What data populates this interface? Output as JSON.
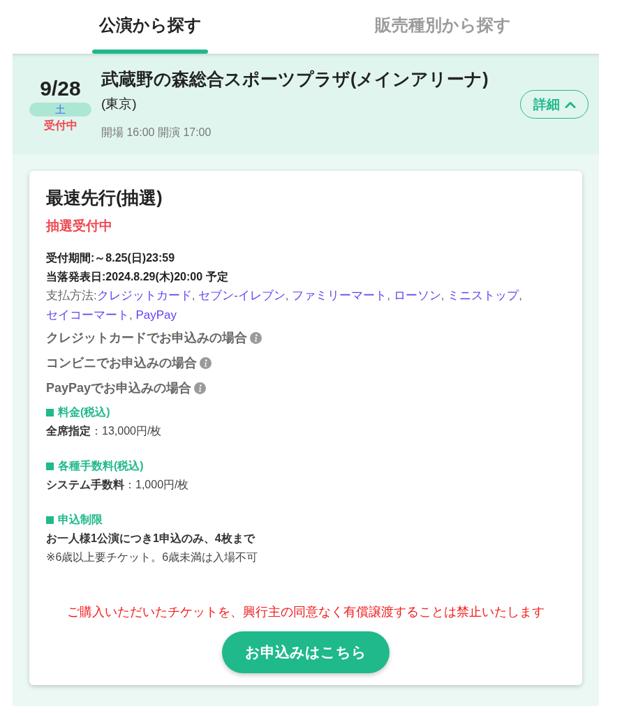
{
  "tabs": [
    {
      "label": "公演から探す",
      "selected": true
    },
    {
      "label": "販売種別から探す",
      "selected": false
    }
  ],
  "performance": {
    "date": "9/28",
    "weekday": "土",
    "status": "受付中",
    "venue": "武蔵野の森総合スポーツプラザ(メインアリーナ)",
    "area": "(東京)",
    "times": "開場 16:00 開演 17:00",
    "detail_button": {
      "label": "詳細",
      "expanded": true
    }
  },
  "sale": {
    "title": "最速先行(抽選)",
    "status": "抽選受付中",
    "period": "受付期間:～8.25(日)23:59",
    "announcement": "当落発表日:2024.8.29(木)20:00 予定",
    "payment": {
      "label": "支払方法:",
      "separator": ", ",
      "methods": [
        "クレジットカード",
        "セブン-イレブン",
        "ファミリーマート",
        "ローソン",
        "ミニストップ",
        "セイコーマート",
        "PayPay"
      ]
    },
    "guides": [
      "クレジットカードでお申込みの場合",
      "コンビニでお申込みの場合",
      "PayPayでお申込みの場合"
    ],
    "sections": [
      {
        "heading": "料金(税込)",
        "lines": [
          {
            "kind": "rich",
            "text": "**全席指定**：13,000円/枚"
          }
        ]
      },
      {
        "heading": "各種手数料(税込)",
        "lines": [
          {
            "kind": "rich",
            "text": "**システム手数料**：1,000円/枚"
          }
        ]
      },
      {
        "heading": "申込制限",
        "lines": [
          {
            "kind": "strong",
            "text": "お一人様1公演につき1申込のみ、4枚まで"
          },
          {
            "kind": "note",
            "text": "※6歳以上要チケット。6歳未満は入場不可"
          }
        ]
      }
    ],
    "notice": "ご購入いただいたチケットを、興行主の同意なく有償譲渡することは禁止いたします",
    "apply_button": "お申込みはこちら"
  }
}
